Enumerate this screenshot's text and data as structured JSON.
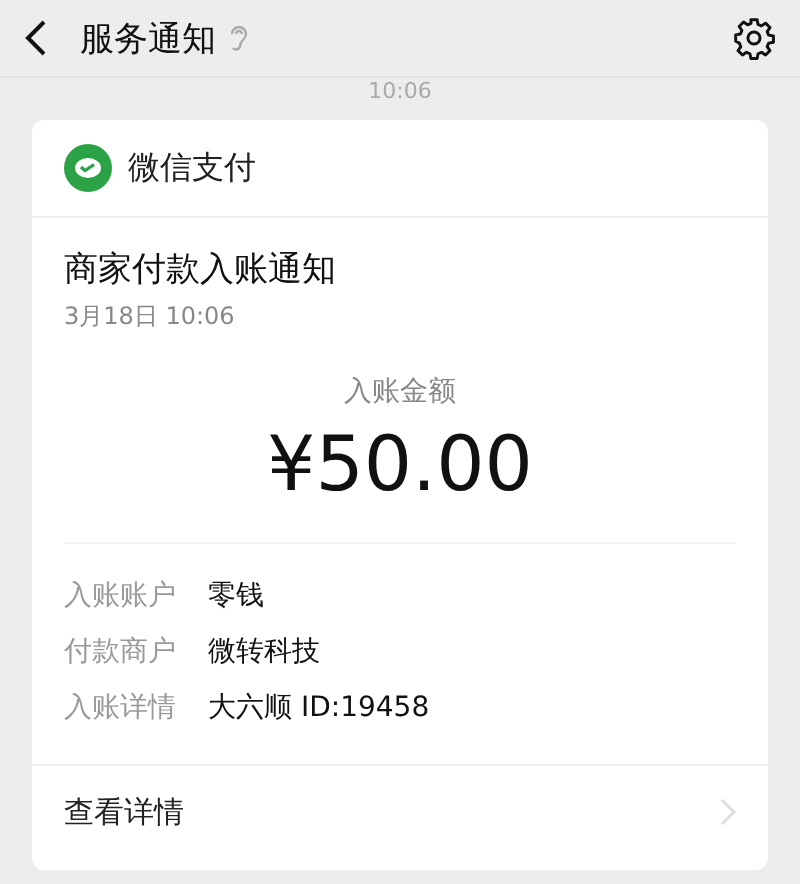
{
  "header": {
    "title": "服务通知"
  },
  "timestamp": "10:06",
  "card": {
    "source": "微信支付",
    "title": "商家付款入账通知",
    "date": "3月18日  10:06",
    "amount_label": "入账金额",
    "amount": "¥50.00",
    "fields": [
      {
        "label": "入账账户",
        "value": "零钱"
      },
      {
        "label": "付款商户",
        "value": "微转科技"
      },
      {
        "label": "入账详情",
        "value": "大六顺 ID:19458"
      }
    ],
    "link": "查看详情"
  }
}
